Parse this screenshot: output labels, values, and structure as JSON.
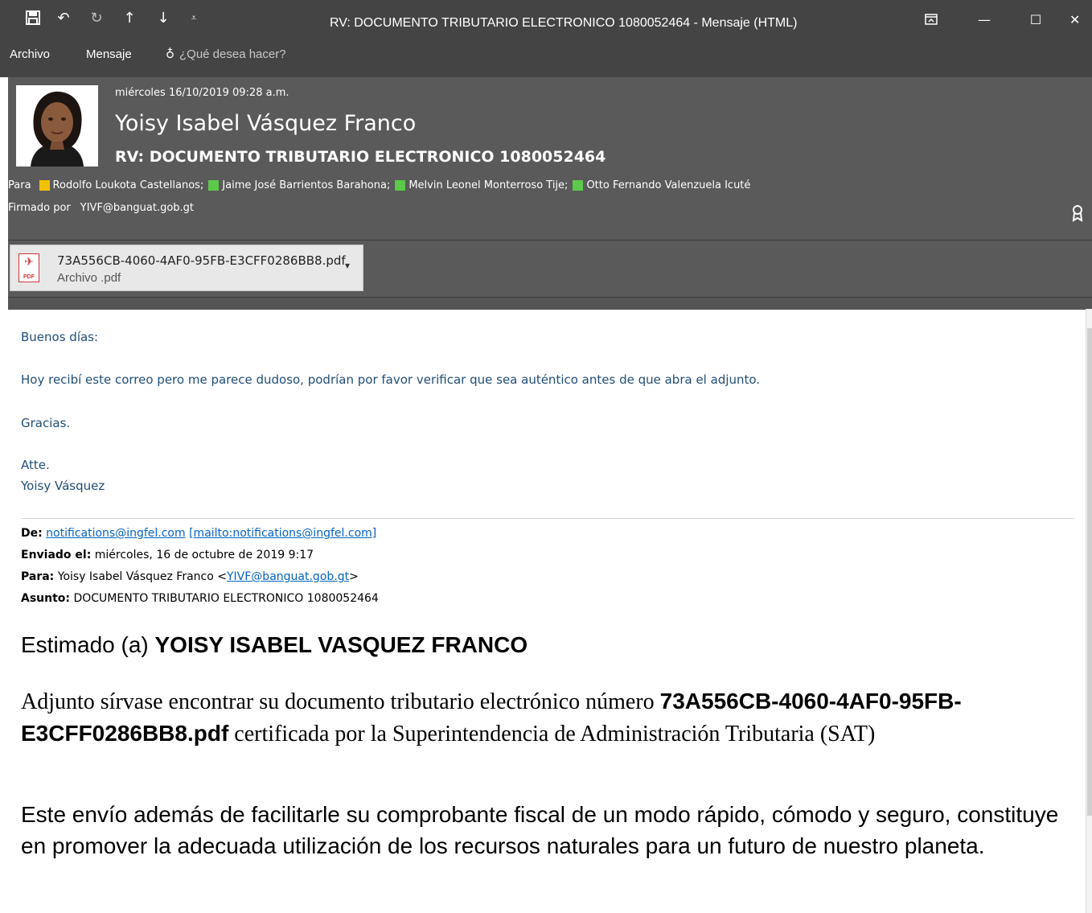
{
  "window": {
    "title": "RV: DOCUMENTO TRIBUTARIO ELECTRONICO 1080052464 - Mensaje (HTML)",
    "qat_icons": [
      "save-icon",
      "undo-icon",
      "redo-icon",
      "previous-item-icon",
      "next-item-icon",
      "customize-qat-icon"
    ],
    "controls": [
      "ribbon-display-icon",
      "minimize-icon",
      "maximize-icon",
      "close-icon"
    ]
  },
  "ribbon": {
    "tabs": [
      "Archivo",
      "Mensaje"
    ],
    "tell_me_placeholder": "¿Qué desea hacer?"
  },
  "header": {
    "date": "miércoles 16/10/2019 09:28 a.m.",
    "sender": "Yoisy Isabel Vásquez Franco",
    "subject": "RV: DOCUMENTO TRIBUTARIO ELECTRONICO 1080052464",
    "to_label": "Para",
    "recipients": [
      {
        "name": "Rodolfo Loukota Castellanos;",
        "status_color": "#f2c200"
      },
      {
        "name": "Jaime José Barrientos Barahona;",
        "status_color": "#5cc94a"
      },
      {
        "name": "Melvin Leonel Monterroso Tije;",
        "status_color": "#5cc94a"
      },
      {
        "name": "Otto Fernando Valenzuela Icuté",
        "status_color": "#5cc94a"
      }
    ],
    "signed_label": "Firmado por",
    "signed_by": "YIVF@banguat.gob.gt"
  },
  "attachment": {
    "name": "73A556CB-4060-4AF0-95FB-E3CFF0286BB8.pdf",
    "type": "Archivo .pdf",
    "icon_badge": "PDF"
  },
  "body": {
    "greeting": "Buenos días:",
    "message": "Hoy recibí este correo pero me parece dudoso, podrían por favor verificar que sea auténtico antes de que abra el adjunto.",
    "thanks": "Gracias.",
    "closing": "Atte.",
    "signature": "Yoisy Vásquez"
  },
  "forwarded": {
    "from_label": "De:",
    "from_email": "notifications@ingfel.com",
    "from_mailto": "[mailto:notifications@ingfel.com]",
    "sent_label": "Enviado el:",
    "sent_value": "miércoles, 16 de octubre de 2019 9:17",
    "to_label": "Para:",
    "to_name": "Yoisy Isabel Vásquez Franco <",
    "to_email": "YIVF@banguat.gob.gt",
    "to_close": ">",
    "subject_label": "Asunto:",
    "subject_value": "DOCUMENTO TRIBUTARIO ELECTRONICO 1080052464",
    "greeting_prefix": "Estimado (a)",
    "greeting_name": "YOISY ISABEL VASQUEZ FRANCO",
    "para1_prefix": "Adjunto sírvase encontrar su documento tributario electrónico número",
    "para1_doc": "73A556CB-4060-4AF0-95FB-E3CFF0286BB8.pdf",
    "para1_suffix": "certificada por la Superintendencia de Administración Tributaria (SAT)",
    "para2": "Este envío además de facilitarle su comprobante fiscal de un modo rápido, cómodo y seguro, constituye en promover la adecuada utilización de los recursos naturales para un futuro de nuestro planeta."
  }
}
